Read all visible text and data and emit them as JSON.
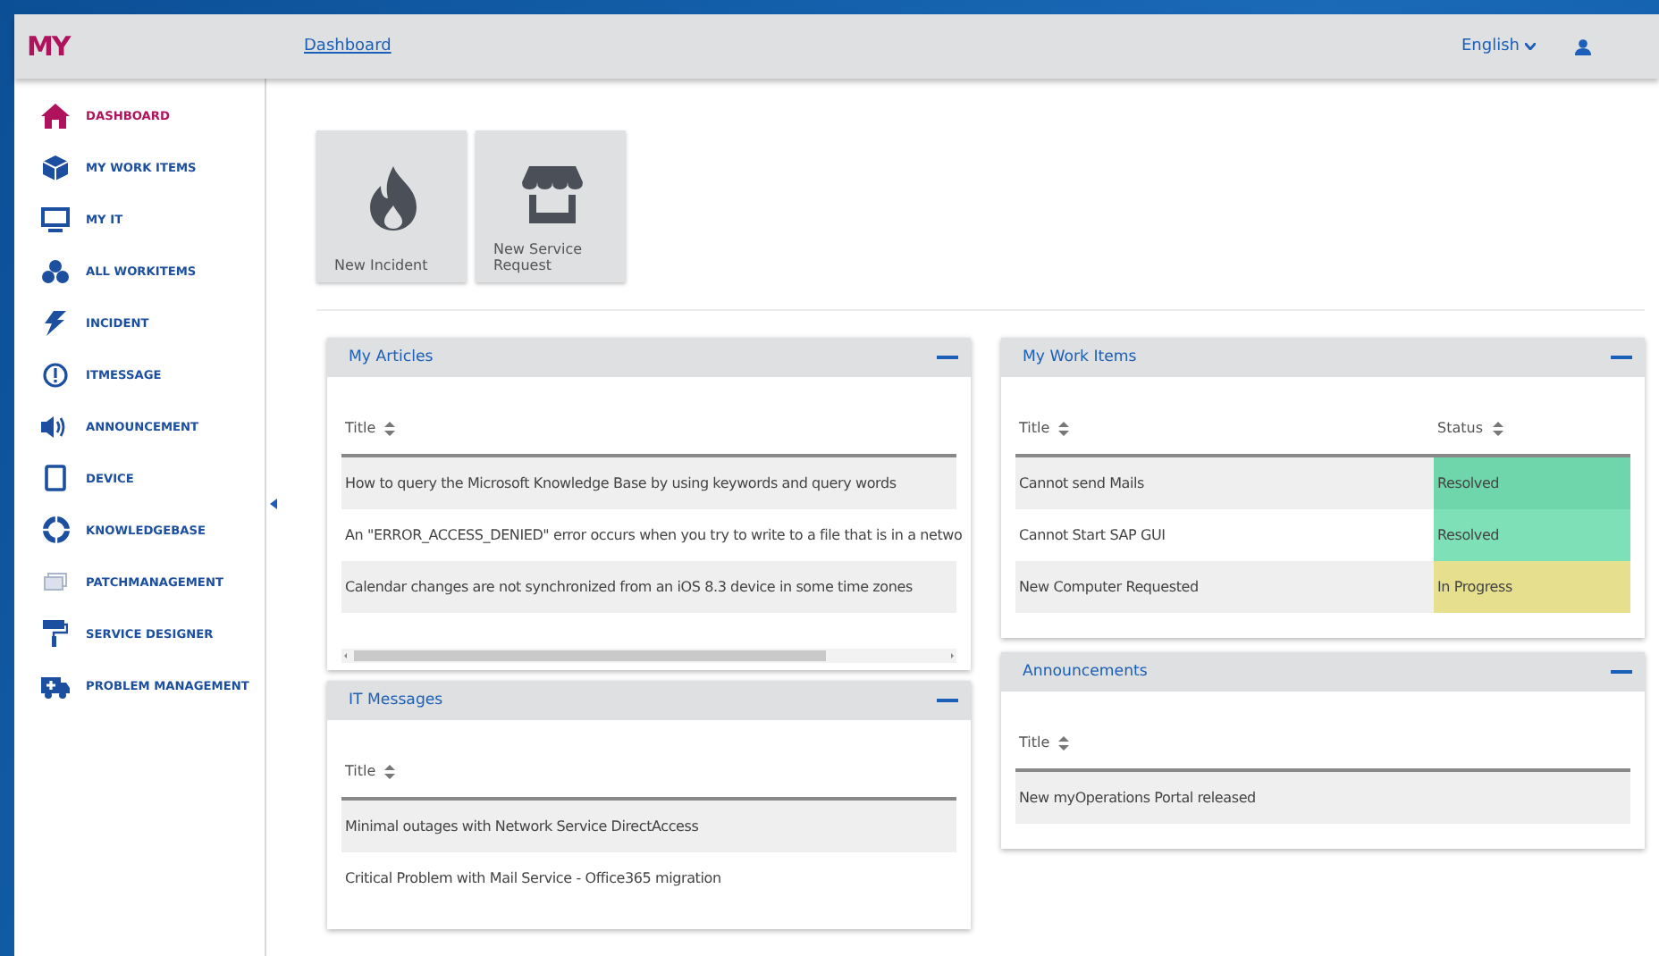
{
  "header": {
    "logo": "MY",
    "breadcrumb": "Dashboard",
    "language": "English"
  },
  "sidebar": {
    "items": [
      {
        "label": "DASHBOARD",
        "selected": true
      },
      {
        "label": "MY WORK ITEMS",
        "selected": false
      },
      {
        "label": "MY IT",
        "selected": false
      },
      {
        "label": "ALL WORKITEMS",
        "selected": false
      },
      {
        "label": "INCIDENT",
        "selected": false
      },
      {
        "label": "ITMESSAGE",
        "selected": false
      },
      {
        "label": "ANNOUNCEMENT",
        "selected": false
      },
      {
        "label": "DEVICE",
        "selected": false
      },
      {
        "label": "KNOWLEDGEBASE",
        "selected": false
      },
      {
        "label": "PATCHMANAGEMENT",
        "selected": false
      },
      {
        "label": "SERVICE DESIGNER",
        "selected": false
      },
      {
        "label": "PROBLEM MANAGEMENT",
        "selected": false
      }
    ]
  },
  "tiles": [
    {
      "label": "New Incident"
    },
    {
      "label": "New Service Request"
    }
  ],
  "left_panels": [
    {
      "title": "My Articles",
      "columns": [
        "Title"
      ],
      "horizontal_scrollbar": true,
      "rows": [
        {
          "cells": [
            "How to query the Microsoft Knowledge Base by using keywords and query words"
          ]
        },
        {
          "cells": [
            "An \"ERROR_ACCESS_DENIED\" error occurs when you try to write to a file that is in a netwo"
          ]
        },
        {
          "cells": [
            "Calendar changes are not synchronized from an iOS 8.3 device in some time zones"
          ]
        }
      ]
    },
    {
      "title": "IT Messages",
      "columns": [
        "Title"
      ],
      "horizontal_scrollbar": false,
      "rows": [
        {
          "cells": [
            "Minimal outages with Network Service DirectAccess"
          ]
        },
        {
          "cells": [
            "Critical Problem with Mail Service - Office365 migration"
          ]
        }
      ]
    }
  ],
  "right_panels": [
    {
      "title": "My Work Items",
      "columns": [
        "Title",
        "Status"
      ],
      "horizontal_scrollbar": false,
      "rows": [
        {
          "cells": [
            "Cannot send Mails",
            "Resolved"
          ],
          "color": "#6fd6ab"
        },
        {
          "cells": [
            "Cannot Start SAP GUI",
            "Resolved"
          ],
          "color": "#7ee0b6"
        },
        {
          "cells": [
            "New Computer Requested",
            "In Progress"
          ],
          "color": "#e6df8e"
        }
      ]
    },
    {
      "title": "Announcements",
      "columns": [
        "Title"
      ],
      "horizontal_scrollbar": false,
      "rows": [
        {
          "cells": [
            "New myOperations Portal released"
          ]
        }
      ]
    }
  ]
}
